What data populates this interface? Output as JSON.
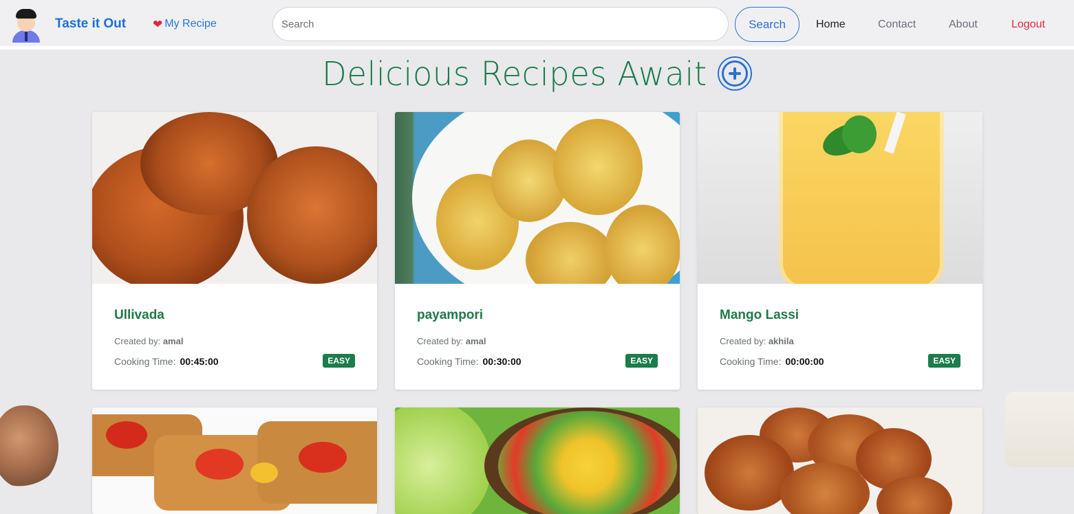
{
  "navbar": {
    "brand": "Taste it Out",
    "my_recipe": "My Recipe",
    "search_placeholder": "Search",
    "search_button": "Search",
    "links": {
      "home": "Home",
      "contact": "Contact",
      "about": "About",
      "logout": "Logout"
    }
  },
  "page": {
    "title": "Delicious Recipes Await"
  },
  "labels": {
    "created_by": "Created by:",
    "cooking_time": "Cooking Time:"
  },
  "recipes": [
    {
      "name": "Ullivada",
      "creator": "amal",
      "time": "00:45:00",
      "difficulty": "EASY"
    },
    {
      "name": "payampori",
      "creator": "amal",
      "time": "00:30:00",
      "difficulty": "EASY"
    },
    {
      "name": "Mango Lassi",
      "creator": "akhila",
      "time": "00:00:00",
      "difficulty": "EASY"
    }
  ],
  "colors": {
    "brand_blue": "#1d6fd8",
    "accent_green": "#1c7c4b",
    "logout_red": "#e0283b"
  },
  "icons": {
    "heart": "heart-icon",
    "add": "plus-circle-icon",
    "avatar": "chef-avatar-icon"
  }
}
